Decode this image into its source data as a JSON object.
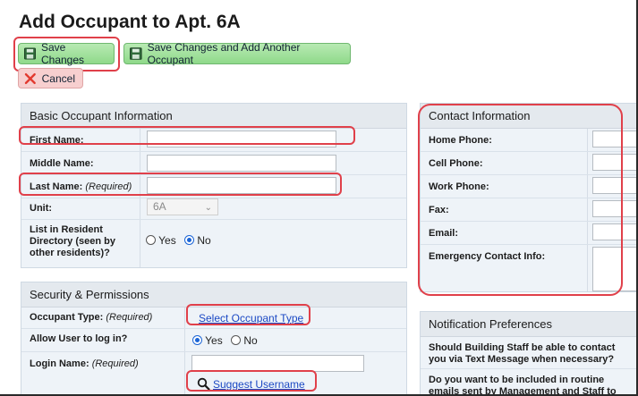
{
  "page": {
    "title": "Add Occupant to Apt. 6A"
  },
  "toolbar": {
    "save_label": "Save Changes",
    "save_add_label": "Save Changes and Add Another Occupant",
    "cancel_label": "Cancel"
  },
  "basic_info": {
    "header": "Basic Occupant Information",
    "first_name_label": "First Name:",
    "middle_name_label": "Middle Name:",
    "last_name_label": "Last Name:",
    "last_name_req": "(Required)",
    "unit_label": "Unit:",
    "unit_value": "6A",
    "directory_label_1": "List in Resident",
    "directory_label_2": "Directory (seen by",
    "directory_label_3": "other residents)?",
    "yes": "Yes",
    "no": "No",
    "directory_selected": "No"
  },
  "security": {
    "header": "Security & Permissions",
    "occupant_type_label": "Occupant Type:",
    "occupant_type_req": "(Required)",
    "select_type_link": "Select Occupant Type",
    "allow_login_label": "Allow User to log in?",
    "yes": "Yes",
    "no": "No",
    "allow_login_selected": "Yes",
    "login_name_label": "Login Name:",
    "login_name_req": "(Required)",
    "suggest_label": "Suggest Username"
  },
  "contact": {
    "header": "Contact Information",
    "home_phone": "Home Phone:",
    "cell_phone": "Cell Phone:",
    "work_phone": "Work Phone:",
    "fax": "Fax:",
    "email": "Email:",
    "emergency": "Emergency Contact Info:"
  },
  "notifications": {
    "header": "Notification Preferences",
    "q1_line1": "Should Building Staff be able to contact",
    "q1_line2": "you via Text Message when necessary?",
    "q2_line1": "Do you want to be included in routine",
    "q2_line2": "emails sent by Management and Staff to"
  },
  "colors": {
    "highlight": "#e0404a",
    "save_green": "#8fd98a",
    "cancel_red": "#f7cfcf",
    "link_blue": "#1b49c4"
  },
  "icons": {
    "save": "floppy-disk-icon",
    "save_add": "floppy-disk-icon",
    "cancel": "x-icon",
    "suggest": "magnifier-icon"
  }
}
